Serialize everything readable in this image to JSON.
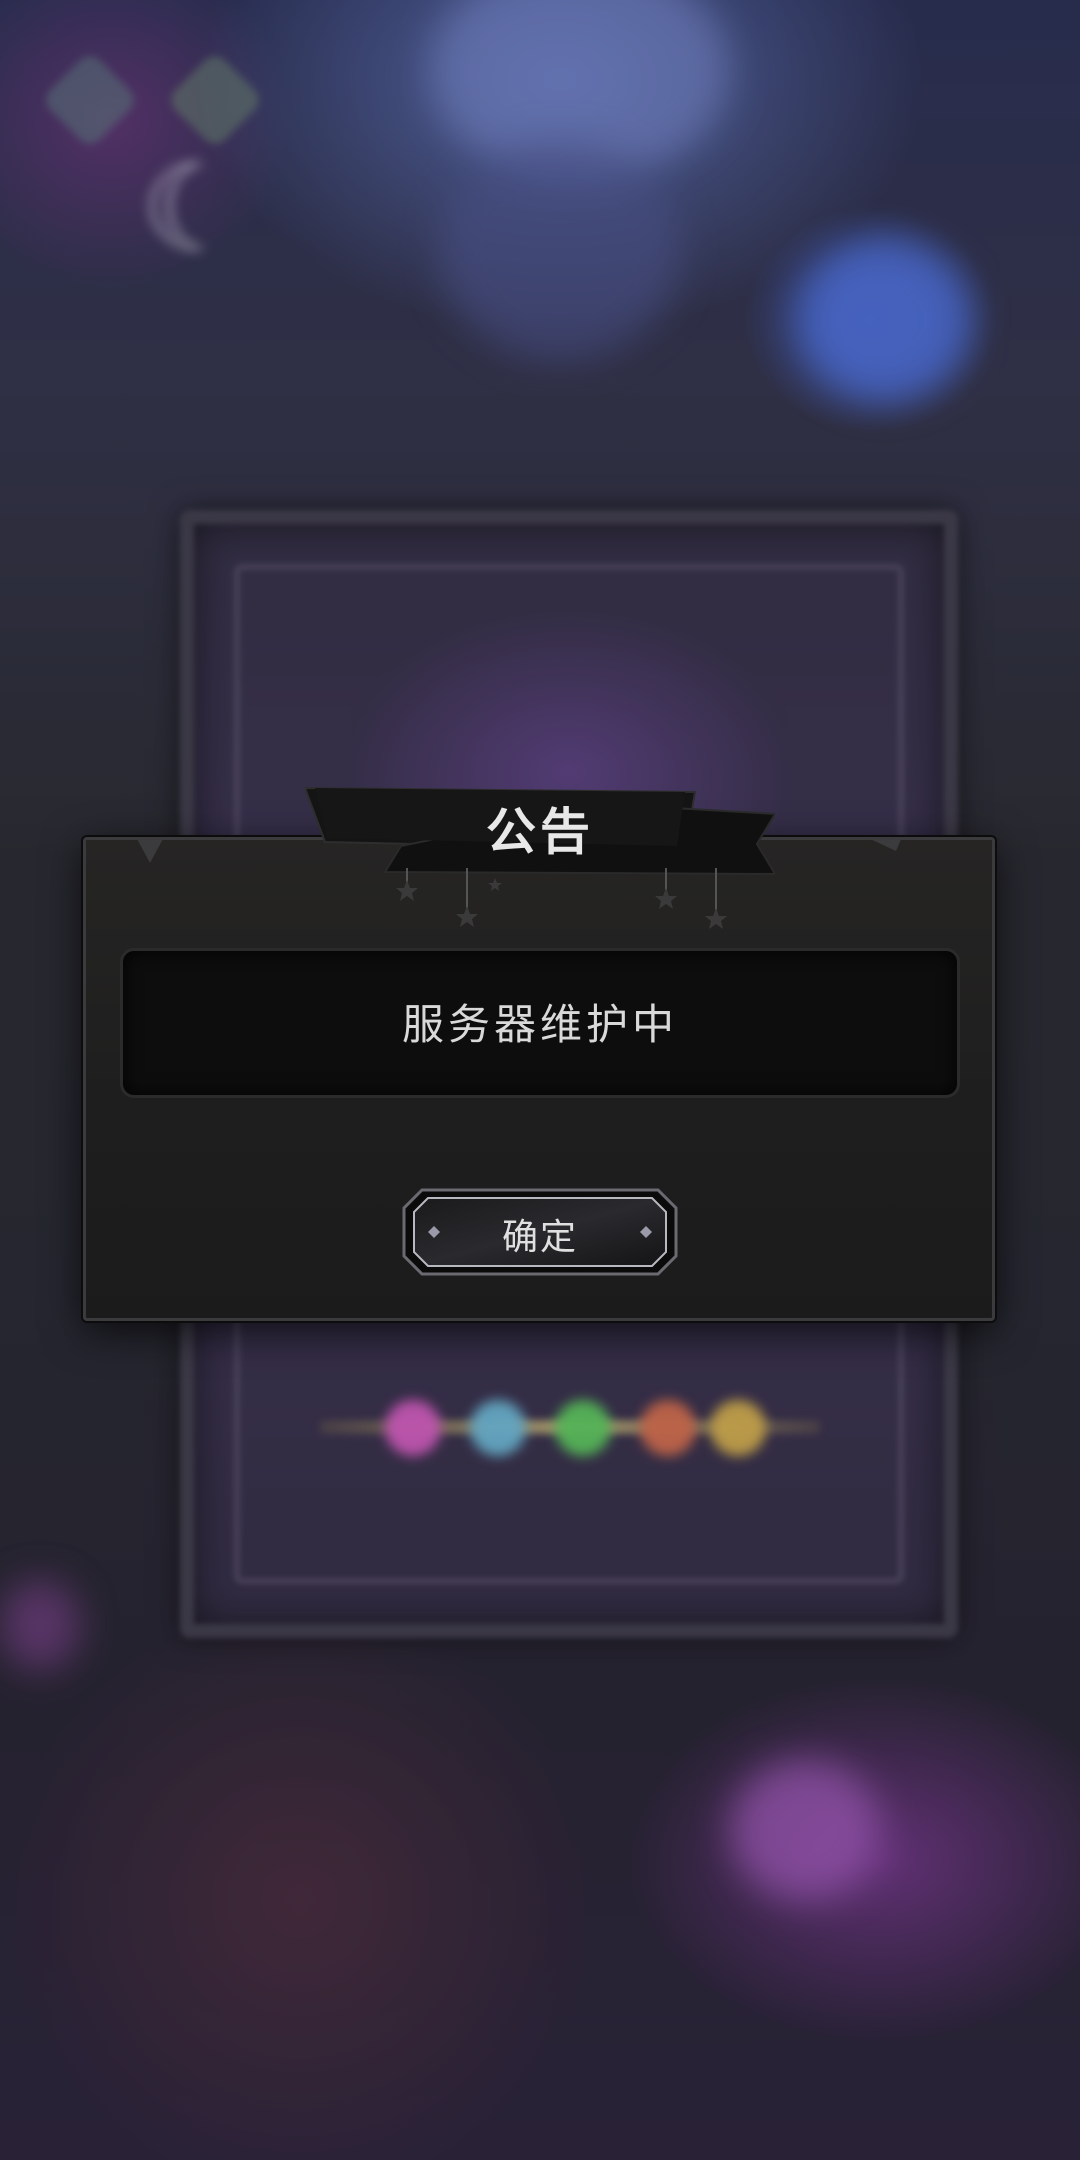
{
  "app": {
    "icons": [
      "app-corner-icon-1",
      "app-corner-icon-2"
    ]
  },
  "dialog": {
    "title": "公告",
    "message": "服务器维护中",
    "confirm_label": "确定"
  },
  "colors": {
    "dialog_bg": "#1e1e1e",
    "message_bg": "#0d0d0d",
    "text": "#d9d9d9",
    "banner": "#161616"
  }
}
